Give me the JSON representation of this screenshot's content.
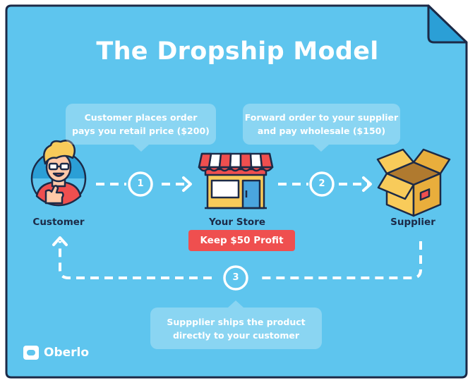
{
  "title": "The Dropship Model",
  "nodes": {
    "customer": "Customer",
    "store": "Your Store",
    "supplier": "Supplier"
  },
  "profit_badge": "Keep $50 Profit",
  "steps": [
    {
      "number": "1",
      "lines": [
        "Customer places order",
        "pays you retail price ($200)"
      ]
    },
    {
      "number": "2",
      "lines": [
        "Forward order to your supplier",
        "and pay wholesale ($150)"
      ]
    },
    {
      "number": "3",
      "lines": [
        "Suppplier ships the product",
        "directly to your customer"
      ]
    }
  ],
  "brand": {
    "name": "Oberlo",
    "icon": "oberlo-logo-icon"
  },
  "colors": {
    "background": "#5ec5ee",
    "outline": "#1c2a47",
    "arrow": "#ffffff",
    "profit_badge": "#ef4f4f",
    "store_awning_red": "#ef4f4f",
    "store_awning_white": "#ffffff",
    "store_door": "#4aa6df",
    "box": "#f8cb5a",
    "customer_hair": "#f8cb5a",
    "customer_shirt": "#ef4f4f"
  }
}
